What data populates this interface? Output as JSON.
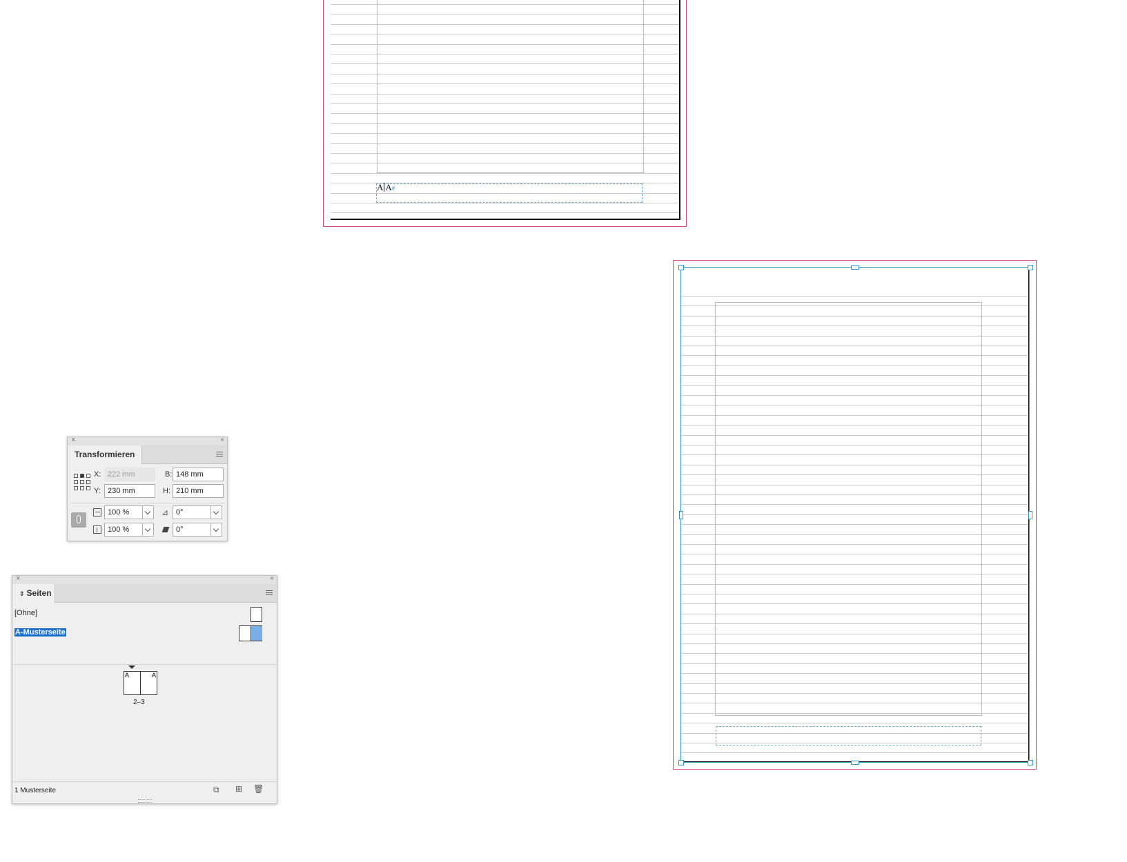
{
  "top_spread": {
    "footer_marker": "A",
    "footer_marker_2": "A",
    "page_number_glyph": "#"
  },
  "transform_panel": {
    "tab_label": "Transformieren",
    "x_label": "X:",
    "x_value": "222 mm",
    "y_label": "Y:",
    "y_value": "230 mm",
    "w_label": "B:",
    "w_value": "148 mm",
    "h_label": "H:",
    "h_value": "210 mm",
    "scale_x_value": "100 %",
    "scale_y_value": "100 %",
    "rotation_value": "0°",
    "shear_value": "0°"
  },
  "pages_panel": {
    "tab_label": "Seiten",
    "masters": [
      {
        "label": "[Ohne]"
      },
      {
        "label": "A-Musterseite"
      }
    ],
    "spread_left_letter": "A",
    "spread_right_letter": "A",
    "spread_label": "2–3",
    "footer_status": "1 Musterseite"
  },
  "colors": {
    "bleed": "#d64b7c",
    "selection": "#2c96c9",
    "selected_label_bg": "#1a6fd0",
    "master_thumb_fill": "#7aaee8"
  }
}
